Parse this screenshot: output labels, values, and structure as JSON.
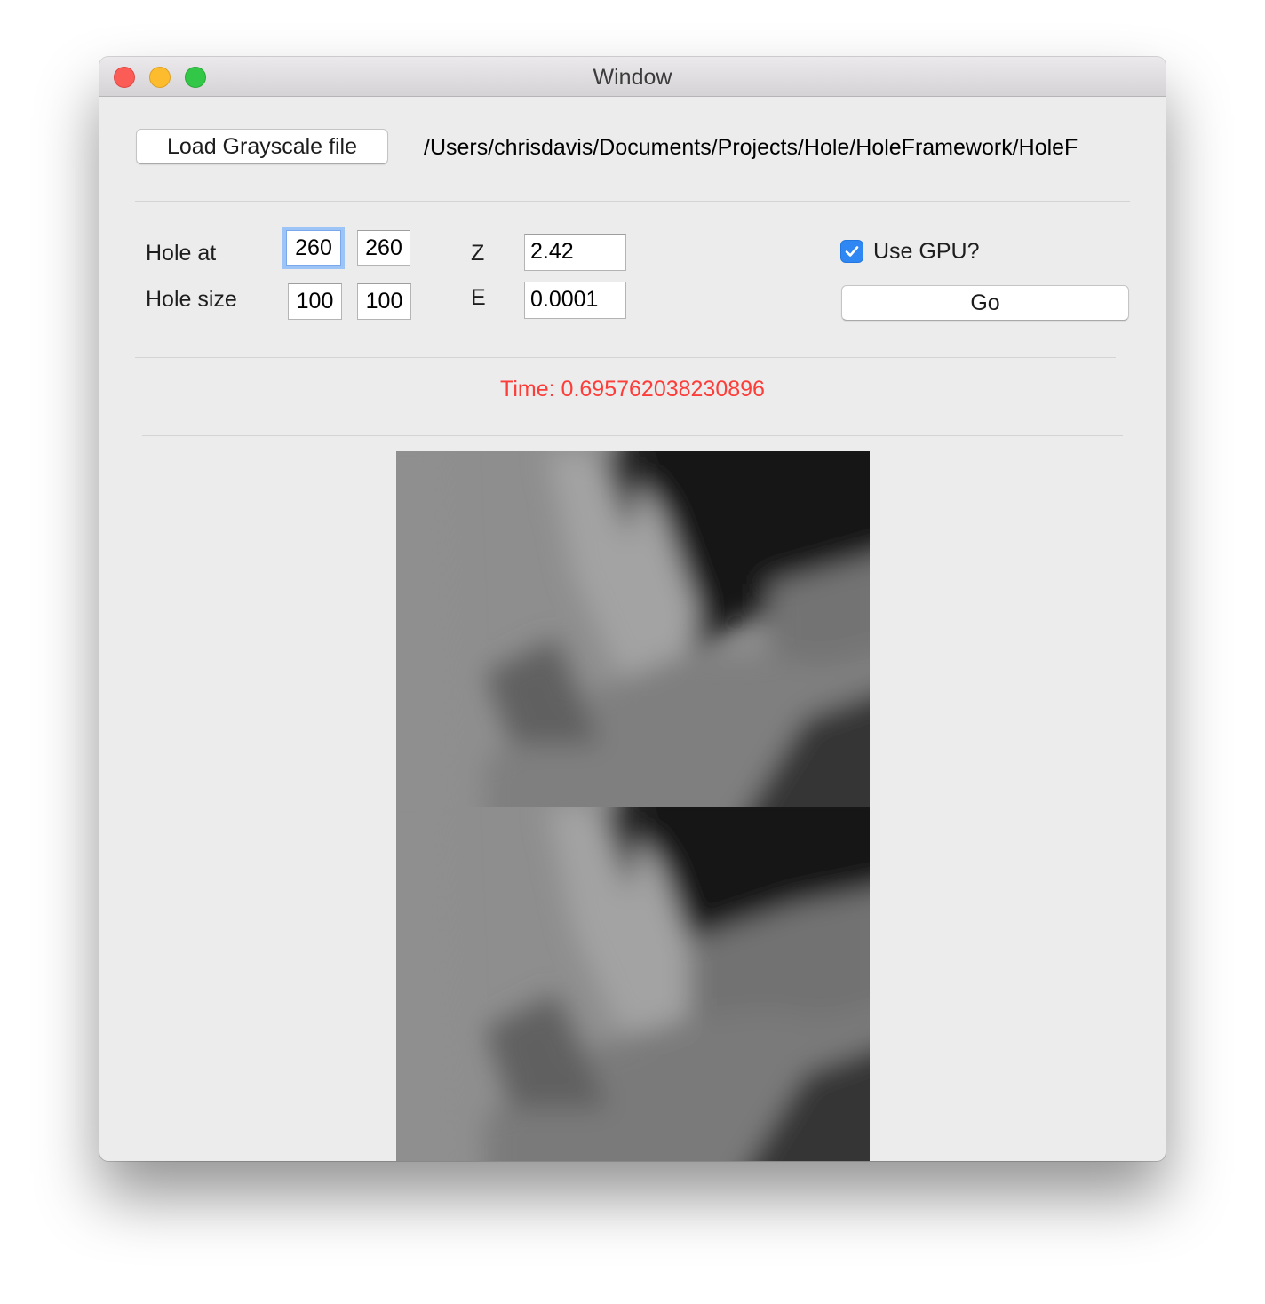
{
  "window": {
    "title": "Window"
  },
  "toolbar": {
    "load_label": "Load Grayscale file",
    "file_path": "/Users/chrisdavis/Documents/Projects/Hole/HoleFramework/HoleF"
  },
  "params": {
    "hole_at_label": "Hole at",
    "hole_at_x": "260",
    "hole_at_y": "260",
    "hole_size_label": "Hole size",
    "hole_size_w": "100",
    "hole_size_h": "100",
    "z_label": "Z",
    "z_value": "2.42",
    "e_label": "E",
    "e_value": "0.0001",
    "use_gpu_label": "Use GPU?",
    "use_gpu_checked": true,
    "go_label": "Go"
  },
  "result": {
    "time_text": "Time: 0.695762038230896"
  },
  "colors": {
    "accent": "#2f87f3",
    "time_text": "#fc3d39",
    "focus_ring": "#9cc4f6"
  }
}
